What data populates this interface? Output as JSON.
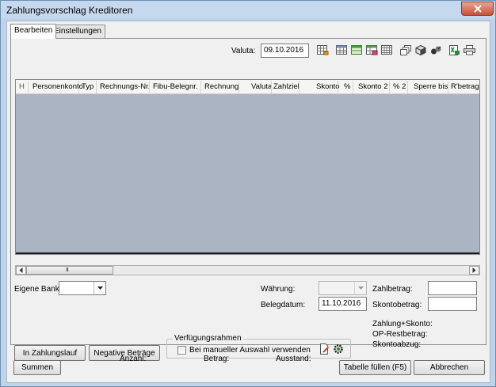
{
  "window": {
    "title": "Zahlungsvorschlag Kreditoren"
  },
  "tabs": [
    {
      "label": "Bearbeiten",
      "active": true
    },
    {
      "label": "Einstellungen",
      "active": false
    }
  ],
  "toolbar": {
    "valuta_label": "Valuta:",
    "valuta_value": "09.10.2016",
    "icons": [
      "grid-calendar-icon",
      "table-icon",
      "table-green-icon",
      "table-edit-icon",
      "table-grid-icon",
      "copy-stack-icon",
      "cube-icon",
      "swap-icon",
      "excel-export-icon",
      "print-icon"
    ]
  },
  "table": {
    "columns": [
      "H",
      "Personenkonto",
      "Typ",
      "Rechnungs-Nr.",
      "Fibu-Belegnr.",
      "Rechnung",
      "Valuta",
      "Zahlziel",
      "Skonto",
      "%",
      "Skonto 2",
      "% 2",
      "Sperre bis",
      "R'betrag"
    ],
    "rows": []
  },
  "scrollbar": {
    "grip": "III"
  },
  "form": {
    "eigene_bank_label": "Eigene Bank:",
    "eigene_bank_value": "",
    "waehrung_label": "Währung:",
    "waehrung_value": "",
    "belegdatum_label": "Belegdatum:",
    "belegdatum_value": "11.10.2016",
    "zahlbetrag_label": "Zahlbetrag:",
    "zahlbetrag_value": "",
    "skontobetrag_label": "Skontobetrag:",
    "skontobetrag_value": "",
    "zahlung_skonto_label": "Zahlung+Skonto:",
    "op_restbetrag_label": "OP-Restbetrag:",
    "skontoabzug_label": "Skontoabzug:"
  },
  "actions": {
    "in_zahlungslauf": "In Zahlungslauf",
    "negative_betraege": "Negative Beträge",
    "verfuegungsrahmen_title": "Verfügungsrahmen",
    "manuelle_auswahl_label": "Bei manueller Auswahl verwenden",
    "manuelle_auswahl_checked": false
  },
  "footer": {
    "summen": "Summen",
    "anzahl_label": "Anzahl:",
    "betrag_label": "Betrag:",
    "ausstand_label": "Ausstand:",
    "tabelle_fuellen": "Tabelle füllen (F5)",
    "abbrechen": "Abbrechen"
  },
  "colors": {
    "title_bar": "#c5d8ee",
    "close_button": "#c7503a",
    "grid_background": "#aab4c2",
    "dialog_background": "#f0f0f0"
  }
}
